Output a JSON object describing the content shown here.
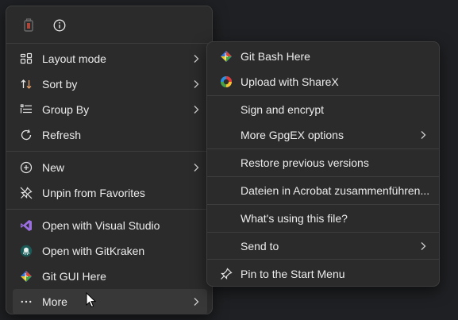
{
  "main_menu": {
    "top_icons": [
      "delete-icon",
      "info-icon"
    ],
    "items": [
      {
        "label": "Layout mode",
        "icon": "layout-grid-icon",
        "has_submenu": true
      },
      {
        "label": "Sort by",
        "icon": "sort-arrows-icon",
        "has_submenu": true
      },
      {
        "label": "Group By",
        "icon": "group-list-icon",
        "has_submenu": true
      },
      {
        "label": "Refresh",
        "icon": "refresh-icon",
        "has_submenu": false
      },
      {
        "label": "New",
        "icon": "new-plus-icon",
        "has_submenu": true
      },
      {
        "label": "Unpin from Favorites",
        "icon": "unpin-icon",
        "has_submenu": false
      },
      {
        "label": "Open with Visual Studio",
        "icon": "visual-studio-icon",
        "has_submenu": false
      },
      {
        "label": "Open with GitKraken",
        "icon": "gitkraken-icon",
        "has_submenu": false
      },
      {
        "label": "Git GUI Here",
        "icon": "git-icon",
        "has_submenu": false
      },
      {
        "label": "More",
        "icon": "more-dots-icon",
        "has_submenu": true
      }
    ]
  },
  "sub_menu": {
    "items": [
      {
        "label": "Git Bash Here",
        "icon": "git-icon",
        "has_submenu": false
      },
      {
        "label": "Upload with ShareX",
        "icon": "sharex-icon",
        "has_submenu": false
      },
      {
        "label": "Sign and encrypt",
        "icon": "",
        "has_submenu": false
      },
      {
        "label": "More GpgEX options",
        "icon": "",
        "has_submenu": true
      },
      {
        "label": "Restore previous versions",
        "icon": "",
        "has_submenu": false
      },
      {
        "label": "Dateien in Acrobat zusammenführen...",
        "icon": "",
        "has_submenu": false
      },
      {
        "label": "What's using this file?",
        "icon": "",
        "has_submenu": false
      },
      {
        "label": "Send to",
        "icon": "",
        "has_submenu": true
      },
      {
        "label": "Pin to the Start Menu",
        "icon": "pin-icon",
        "has_submenu": false
      }
    ]
  },
  "colors": {
    "background": "#1f2023",
    "menu": "#2b2b2b",
    "hover": "#383838",
    "text": "#ececec",
    "visual_studio": "#9b6fe0",
    "git_red": "#e24329"
  }
}
